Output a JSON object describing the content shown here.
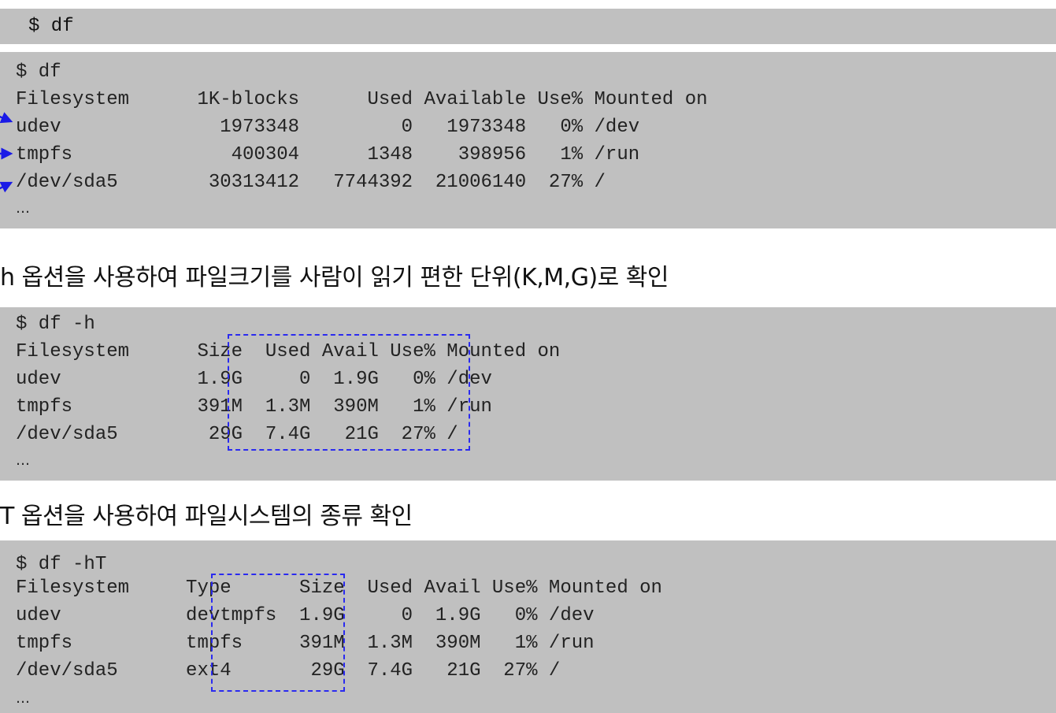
{
  "top_command": "$ df",
  "block1": {
    "lines": [
      "$ df",
      "Filesystem      1K-blocks      Used Available Use% Mounted on",
      "udev              1973348         0   1973348   0% /dev",
      "tmpfs              400304      1348    398956   1% /run",
      "/dev/sda5        30313412   7744392  21006140  27% /"
    ],
    "ellipsis": "…"
  },
  "heading2": "h 옵션을 사용하여 파일크기를 사람이 읽기 편한 단위(K,M,G)로 확인",
  "block2": {
    "lines": [
      "$ df -h",
      "Filesystem      Size  Used Avail Use% Mounted on",
      "udev            1.9G     0  1.9G   0% /dev",
      "tmpfs           391M  1.3M  390M   1% /run",
      "/dev/sda5        29G  7.4G   21G  27% /"
    ],
    "ellipsis": "…"
  },
  "heading3": "T 옵션을 사용하여 파일시스템의 종류 확인",
  "block3": {
    "lines": [
      "$ df -hT",
      "Filesystem     Type      Size  Used Avail Use% Mounted on",
      "udev           devtmpfs  1.9G     0  1.9G   0% /dev",
      "tmpfs          tmpfs     391M  1.3M  390M   1% /run",
      "/dev/sda5      ext4       29G  7.4G   21G  27% /"
    ],
    "ellipsis": "…"
  },
  "colors": {
    "terminal_bg": "#c0c0c0",
    "highlight": "#2a2af0"
  }
}
